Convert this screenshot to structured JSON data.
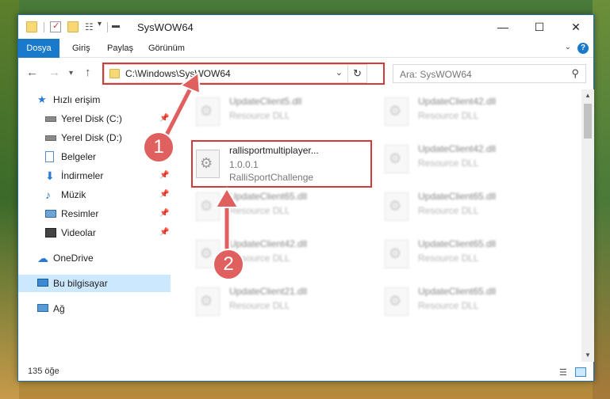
{
  "window": {
    "title": "SysWOW64",
    "minimize": "—",
    "maximize": "☐",
    "close": "✕"
  },
  "ribbon": {
    "tabs": [
      "Dosya",
      "Giriş",
      "Paylaş",
      "Görünüm"
    ],
    "help": "?"
  },
  "nav": {
    "address": "C:\\Windows\\SysWOW64",
    "search_placeholder": "Ara: SysWOW64"
  },
  "sidebar": {
    "items": [
      {
        "label": "Hızlı erişim",
        "icon": "star-icon",
        "pinned": false
      },
      {
        "label": "Yerel Disk (C:)",
        "icon": "drive-icon",
        "pinned": true
      },
      {
        "label": "Yerel Disk (D:)",
        "icon": "drive-icon",
        "pinned": true
      },
      {
        "label": "Belgeler",
        "icon": "documents-icon",
        "pinned": true
      },
      {
        "label": "İndirmeler",
        "icon": "download-icon",
        "pinned": true
      },
      {
        "label": "Müzik",
        "icon": "music-icon",
        "pinned": true
      },
      {
        "label": "Resimler",
        "icon": "pictures-icon",
        "pinned": true
      },
      {
        "label": "Videolar",
        "icon": "videos-icon",
        "pinned": true
      },
      {
        "label": "OneDrive",
        "icon": "cloud-icon",
        "pinned": false
      },
      {
        "label": "Bu bilgisayar",
        "icon": "computer-icon",
        "pinned": false,
        "selected": true
      },
      {
        "label": "Ağ",
        "icon": "network-icon",
        "pinned": false
      }
    ]
  },
  "files": {
    "highlighted": {
      "name": "rallisportmultiplayer...",
      "version": "1.0.0.1",
      "company": "RalliSportChallenge"
    },
    "left_column": [
      {
        "name": "UpdateClient5.dll",
        "desc": "Resource DLL"
      },
      {
        "name": "UpdateClient65.dll",
        "desc": "Resource DLL"
      },
      {
        "name": "UpdateClient42.dll",
        "desc": "Resource DLL"
      },
      {
        "name": "UpdateClient21.dll",
        "desc": "Resource DLL"
      }
    ],
    "right_column": [
      {
        "name": "UpdateClient42.dll",
        "desc": "Resource DLL"
      },
      {
        "name": "UpdateClient42.dll",
        "desc": "Resource DLL"
      },
      {
        "name": "UpdateClient65.dll",
        "desc": "Resource DLL"
      },
      {
        "name": "UpdateClient65.dll",
        "desc": "Resource DLL"
      },
      {
        "name": "UpdateClient65.dll",
        "desc": "Resource DLL"
      }
    ]
  },
  "status": {
    "count": "135 öğe"
  },
  "annotations": {
    "badge1": "1",
    "badge2": "2",
    "color": "#d43a3a"
  }
}
